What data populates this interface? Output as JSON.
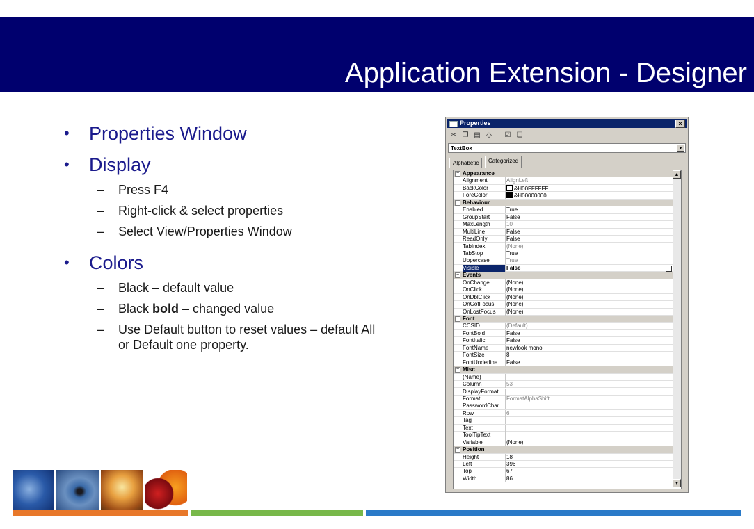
{
  "slide": {
    "title": "Application Extension - Designer",
    "bullets": [
      {
        "text": "Properties Window",
        "sub": []
      },
      {
        "text": "Display",
        "sub": [
          "Press F4",
          "Right-click & select properties",
          "Select View/Properties Window"
        ]
      },
      {
        "text": "Colors",
        "sub": []
      }
    ],
    "colors_sub": {
      "item1": "Black – default value",
      "item2_pre": "Black ",
      "item2_bold": "bold",
      "item2_post": " – changed value",
      "item3": "Use Default button to reset values – default All or Default one property."
    },
    "bullet_char": "•",
    "dash_char": "–"
  },
  "properties_window": {
    "title": "Properties",
    "close": "×",
    "selected_object": "TextBox",
    "tabs": [
      "Alphabetic",
      "Categorized"
    ],
    "active_tab": "Categorized",
    "toolbar_icons": [
      "cut-icon",
      "copy-icon",
      "paste-icon",
      "eraser-icon",
      "default-one-icon",
      "default-all-icon"
    ],
    "rows": [
      {
        "type": "cat",
        "name": "Appearance"
      },
      {
        "name": "Alignment",
        "value": "AlignLeft",
        "dim": true
      },
      {
        "name": "BackColor",
        "value": "&H00FFFFFF",
        "swatch": "#ffffff"
      },
      {
        "name": "ForeColor",
        "value": "&H00000000",
        "swatch": "#000000"
      },
      {
        "type": "cat",
        "name": "Behaviour"
      },
      {
        "name": "Enabled",
        "value": "True"
      },
      {
        "name": "GroupStart",
        "value": "False"
      },
      {
        "name": "MaxLength",
        "value": "10",
        "dim": true
      },
      {
        "name": "MultiLine",
        "value": "False"
      },
      {
        "name": "ReadOnly",
        "value": "False"
      },
      {
        "name": "TabIndex",
        "value": "(None)",
        "dim": true
      },
      {
        "name": "TabStop",
        "value": "True"
      },
      {
        "name": "Uppercase",
        "value": "True",
        "dim": true
      },
      {
        "name": "Visible",
        "value": "False",
        "selected": true
      },
      {
        "type": "cat",
        "name": "Events"
      },
      {
        "name": "OnChange",
        "value": "(None)"
      },
      {
        "name": "OnClick",
        "value": "(None)"
      },
      {
        "name": "OnDblClick",
        "value": "(None)"
      },
      {
        "name": "OnGotFocus",
        "value": "(None)"
      },
      {
        "name": "OnLostFocus",
        "value": "(None)"
      },
      {
        "type": "cat",
        "name": "Font"
      },
      {
        "name": "CCSID",
        "value": "(Default)",
        "dim": true
      },
      {
        "name": "FontBold",
        "value": "False"
      },
      {
        "name": "FontItalic",
        "value": "False"
      },
      {
        "name": "FontName",
        "value": "newlook mono"
      },
      {
        "name": "FontSize",
        "value": "8"
      },
      {
        "name": "FontUnderline",
        "value": "False"
      },
      {
        "type": "cat",
        "name": "Misc"
      },
      {
        "name": "(Name)",
        "value": ""
      },
      {
        "name": "Column",
        "value": "53",
        "dim": true
      },
      {
        "name": "DisplayFormat",
        "value": ""
      },
      {
        "name": "Format",
        "value": "FormatAlphaShift",
        "dim": true
      },
      {
        "name": "PasswordChar",
        "value": ""
      },
      {
        "name": "Row",
        "value": "6",
        "dim": true
      },
      {
        "name": "Tag",
        "value": ""
      },
      {
        "name": "Text",
        "value": ""
      },
      {
        "name": "ToolTipText",
        "value": ""
      },
      {
        "name": "Variable",
        "value": "(None)"
      },
      {
        "type": "cat",
        "name": "Position"
      },
      {
        "name": "Height",
        "value": "18"
      },
      {
        "name": "Left",
        "value": "396"
      },
      {
        "name": "Top",
        "value": "67"
      },
      {
        "name": "Width",
        "value": "86"
      }
    ]
  },
  "theme": {
    "banner": "#00006e",
    "bullet_text": "#1a1a8c",
    "bar_orange": "#e8782a",
    "bar_green": "#78b84a",
    "bar_blue": "#2a7ac8"
  }
}
